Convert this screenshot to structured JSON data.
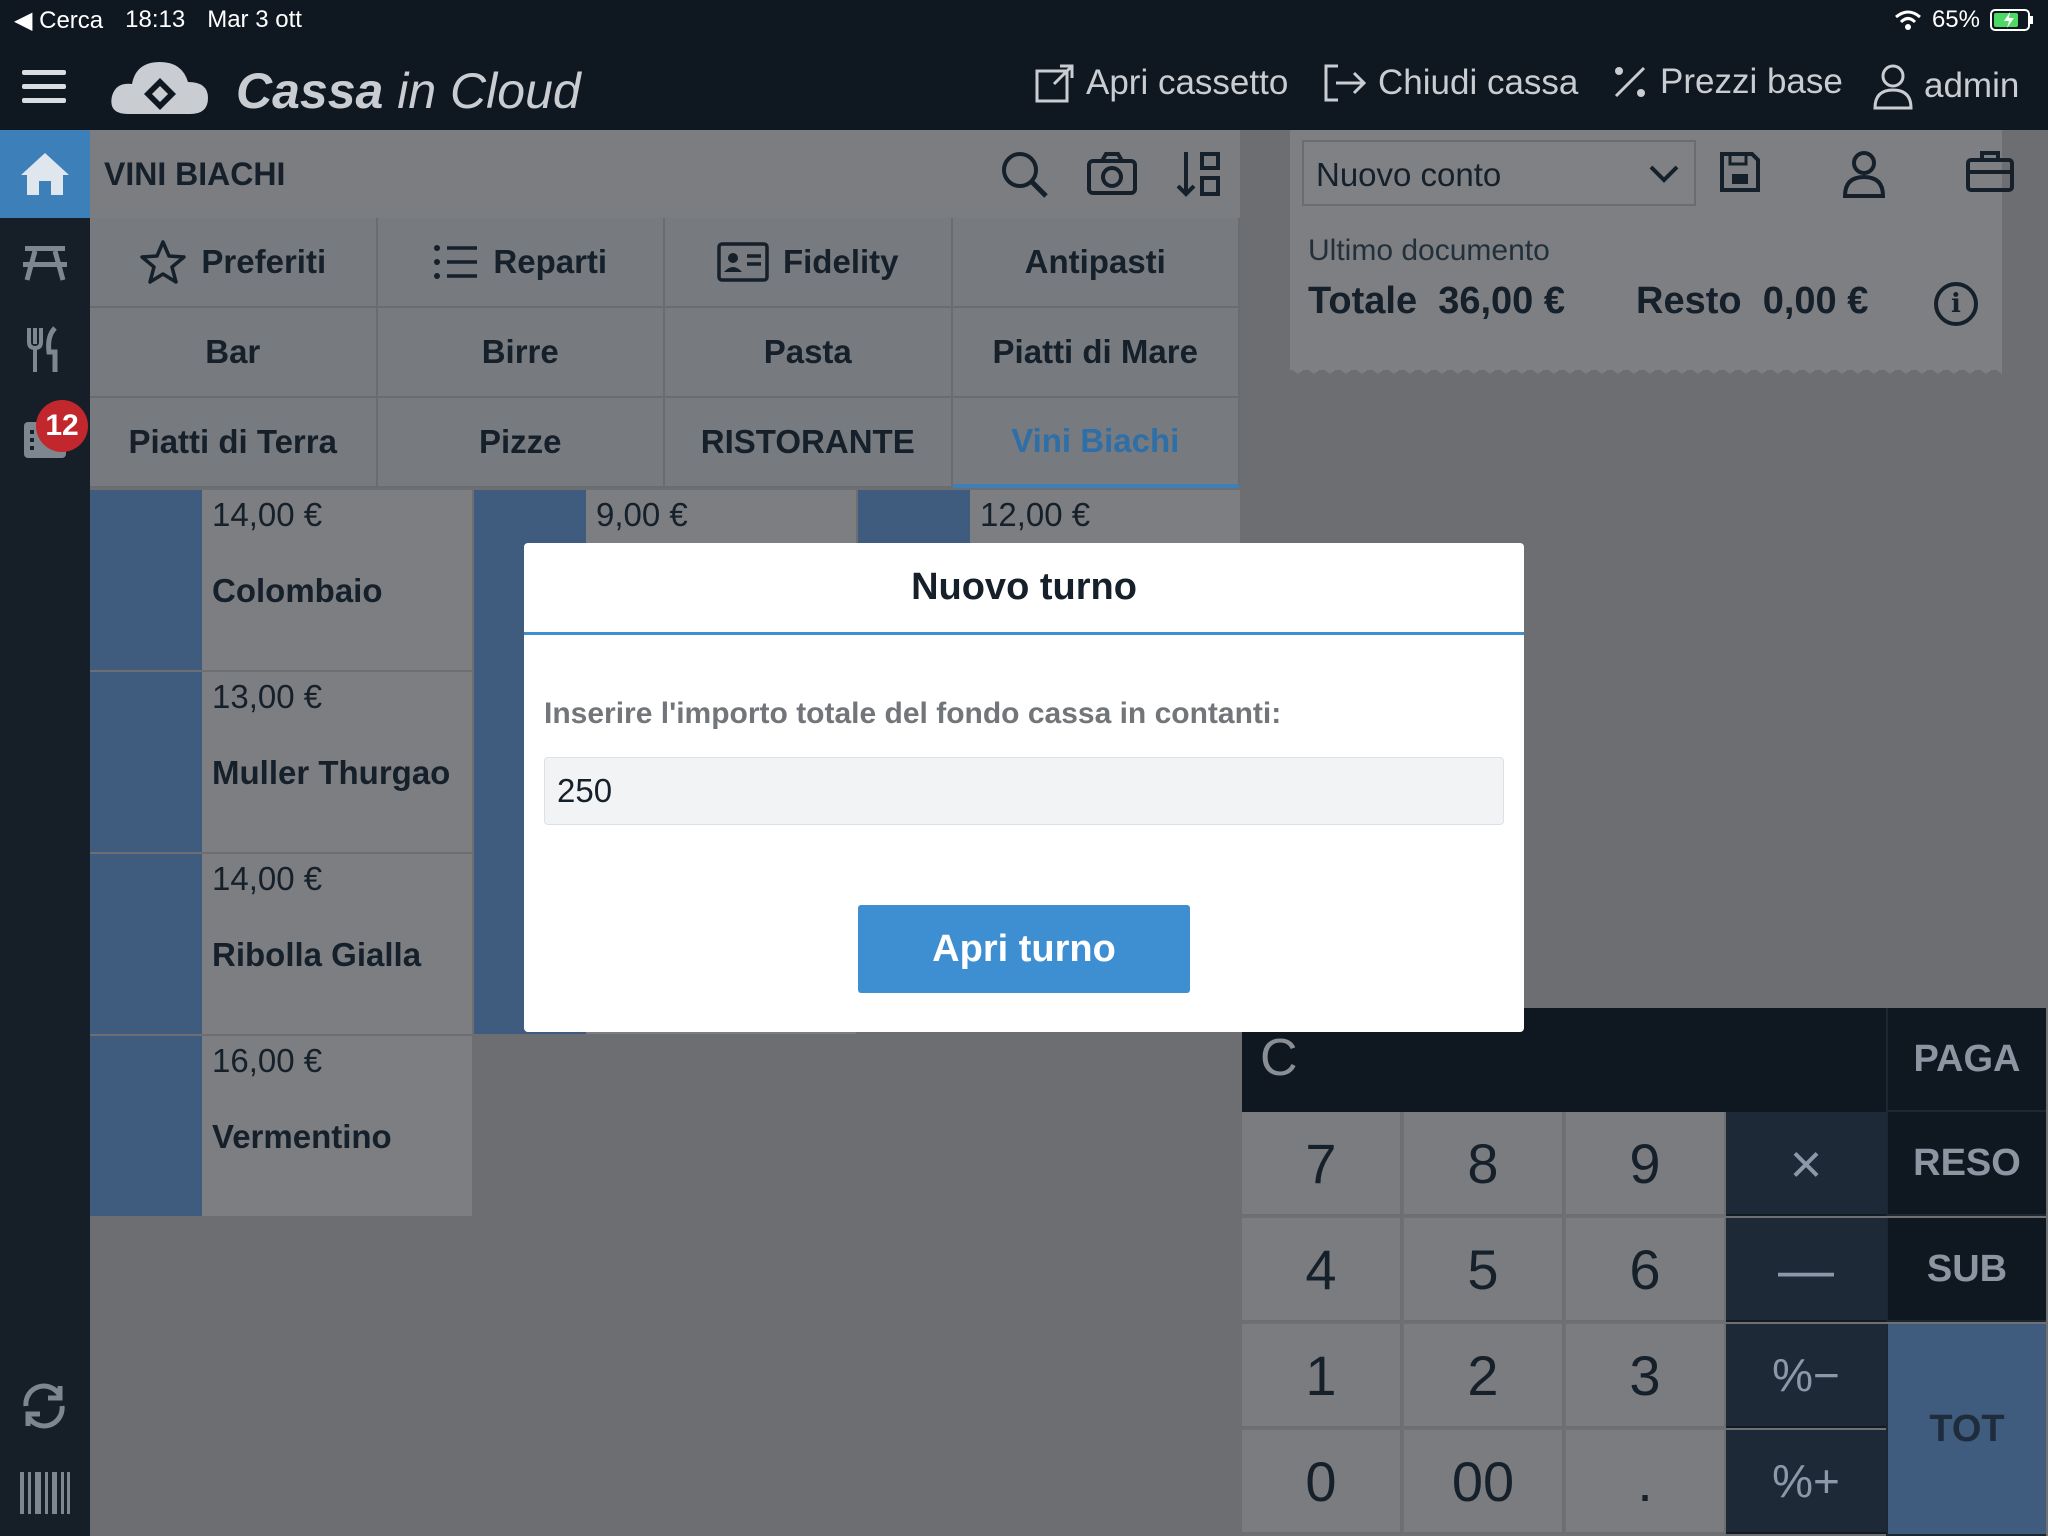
{
  "statusbar": {
    "back": "◀ Cerca",
    "time": "18:13",
    "date": "Mar 3 ott",
    "battery": "65%"
  },
  "app": {
    "brand_bold": "Cassa",
    "brand_rest": " in Cloud"
  },
  "topbar": {
    "open_drawer": "Apri cassetto",
    "close_register": "Chiudi cassa",
    "base_prices": "Prezzi base",
    "user": "admin"
  },
  "sidebar": {
    "badge": "12"
  },
  "main": {
    "title": "VINI BIACHI",
    "categories": [
      "Preferiti",
      "Reparti",
      "Fidelity",
      "Antipasti",
      "Bar",
      "Birre",
      "Pasta",
      "Piatti di Mare",
      "Piatti di Terra",
      "Pizze",
      "RISTORANTE",
      "Vini Biachi"
    ],
    "products": [
      {
        "price": "14,00 €",
        "name": "Colombaio"
      },
      {
        "price": "9,00 €",
        "name": ""
      },
      {
        "price": "12,00 €",
        "name": ""
      },
      {
        "price": "13,00 €",
        "name": "Muller Thurgao"
      },
      {
        "price": "14,00 €",
        "name": "Ribolla Gialla"
      },
      {
        "price": "16,00 €",
        "name": "Vermentino"
      }
    ]
  },
  "right": {
    "account": "Nuovo conto",
    "last_doc": "Ultimo documento",
    "total_label": "Totale",
    "total_value": "36,00 €",
    "change_label": "Resto",
    "change_value": "0,00 €"
  },
  "keypad": {
    "clear": "C",
    "digits": [
      "7",
      "8",
      "9",
      "4",
      "5",
      "6",
      "1",
      "2",
      "3",
      "0",
      "00",
      "."
    ],
    "ops": [
      "×",
      "—",
      "%−",
      "%+"
    ],
    "side": [
      "PAGA",
      "RESO",
      "SUB",
      "TOT"
    ]
  },
  "modal": {
    "title": "Nuovo turno",
    "label": "Inserire l'importo totale del fondo cassa in contanti:",
    "value": "250",
    "button": "Apri turno"
  },
  "colors": {
    "accent": "#3d8fd1",
    "dark": "#0f1821",
    "stripe": "#3f5b7e"
  }
}
